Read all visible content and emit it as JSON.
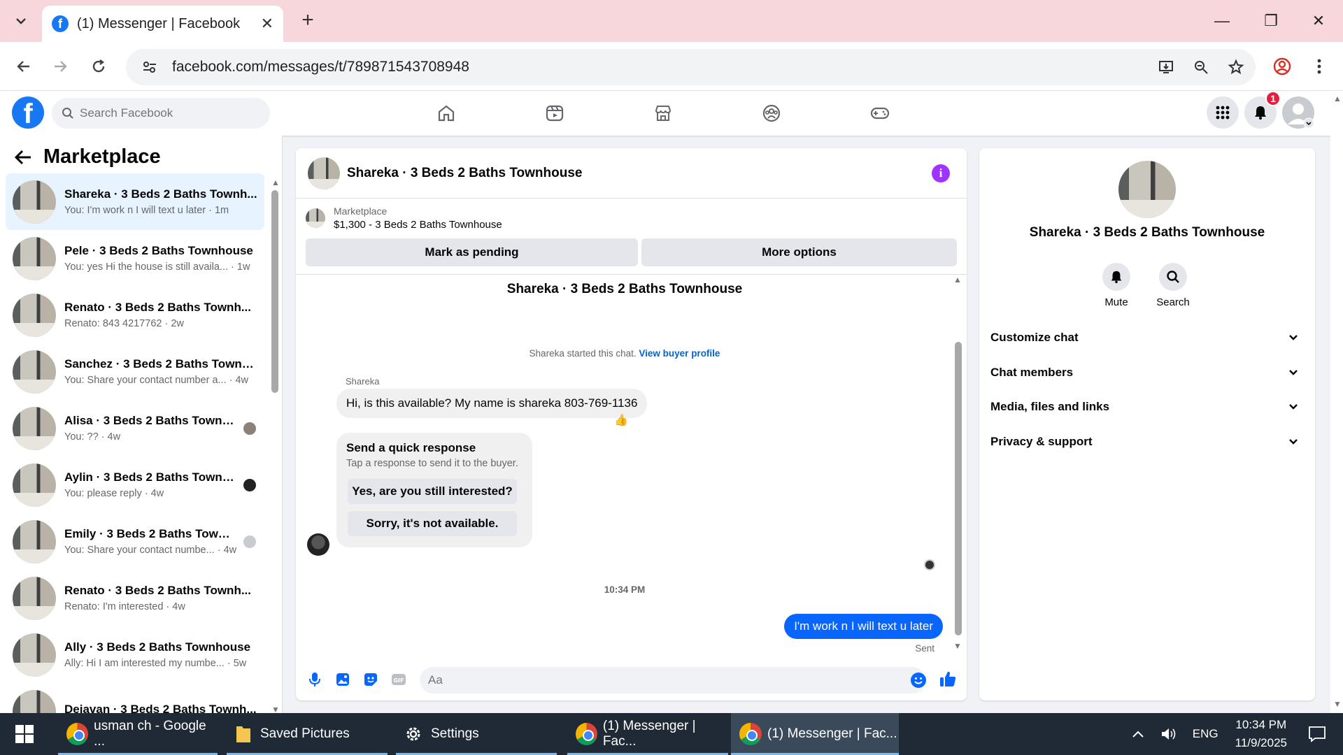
{
  "browser": {
    "tab_title": "(1) Messenger | Facebook",
    "url": "facebook.com/messages/t/789871543708948"
  },
  "fb": {
    "search_placeholder": "Search Facebook",
    "notifications_badge": "1"
  },
  "sidebar": {
    "title": "Marketplace",
    "conversations": [
      {
        "name": "Shareka · 3 Beds 2 Baths Townh...",
        "preview": "You: I'm work n I will text u later · 1m",
        "active": true
      },
      {
        "name": "Pele · 3 Beds 2 Baths Townhouse",
        "preview": "You: yes Hi the house is still availa... · 1w"
      },
      {
        "name": "Renato · 3 Beds 2 Baths Townh...",
        "preview": "Renato: 843 4217762 · 2w"
      },
      {
        "name": "Sanchez · 3 Beds 2 Baths Townh...",
        "preview": "You: Share your contact number a... · 4w"
      },
      {
        "name": "Alisa · 3 Beds 2 Baths Townh...",
        "preview": "You: ?? · 4w"
      },
      {
        "name": "Aylin · 3 Beds 2 Baths Townh...",
        "preview": "You: please reply · 4w"
      },
      {
        "name": "Emily · 3 Beds 2 Baths Townh...",
        "preview": "You: Share your contact numbe... · 4w"
      },
      {
        "name": "Renato · 3 Beds 2 Baths Townh...",
        "preview": "Renato: I'm interested · 4w"
      },
      {
        "name": "Ally · 3 Beds 2 Baths Townhouse",
        "preview": "Ally: Hi I am interested my numbe... · 5w"
      },
      {
        "name": "Dejavan · 3 Beds 2 Baths Townh...",
        "preview": ""
      }
    ]
  },
  "chat": {
    "header_name": "Shareka · 3 Beds 2 Baths Townhouse",
    "marketplace_label": "Marketplace",
    "listing": "$1,300 - 3 Beds 2 Baths Townhouse",
    "mark_pending": "Mark as pending",
    "more_options": "More options",
    "thread_title": "Shareka · 3 Beds 2 Baths Townhouse",
    "started_text": "Shareka started this chat.",
    "view_profile": "View buyer profile",
    "sender_name": "Shareka",
    "incoming_message": "Hi, is this available? My name is shareka 803-769-1136",
    "reaction": "👍",
    "quick_title": "Send a quick response",
    "quick_subtitle": "Tap a response to send it to the buyer.",
    "quick_option_1": "Yes, are you still interested?",
    "quick_option_2": "Sorry, it's not available.",
    "timestamp": "10:34 PM",
    "outgoing_message": "I'm work n I will text u later",
    "sent_status": "Sent",
    "composer_placeholder": "Aa"
  },
  "details": {
    "name": "Shareka · 3 Beds 2 Baths Townhouse",
    "mute": "Mute",
    "search": "Search",
    "sections": [
      "Customize chat",
      "Chat members",
      "Media, files and links",
      "Privacy & support"
    ]
  },
  "taskbar": {
    "items": [
      "usman ch - Google ...",
      "Saved Pictures",
      "Settings",
      "(1) Messenger | Fac...",
      "(1) Messenger | Fac..."
    ],
    "language": "ENG",
    "time": "10:34 PM",
    "date": "11/9/2025"
  },
  "colors": {
    "fb_blue": "#1877f2",
    "messenger_blue": "#0866ff",
    "tab_strip": "#f8d7dc"
  }
}
